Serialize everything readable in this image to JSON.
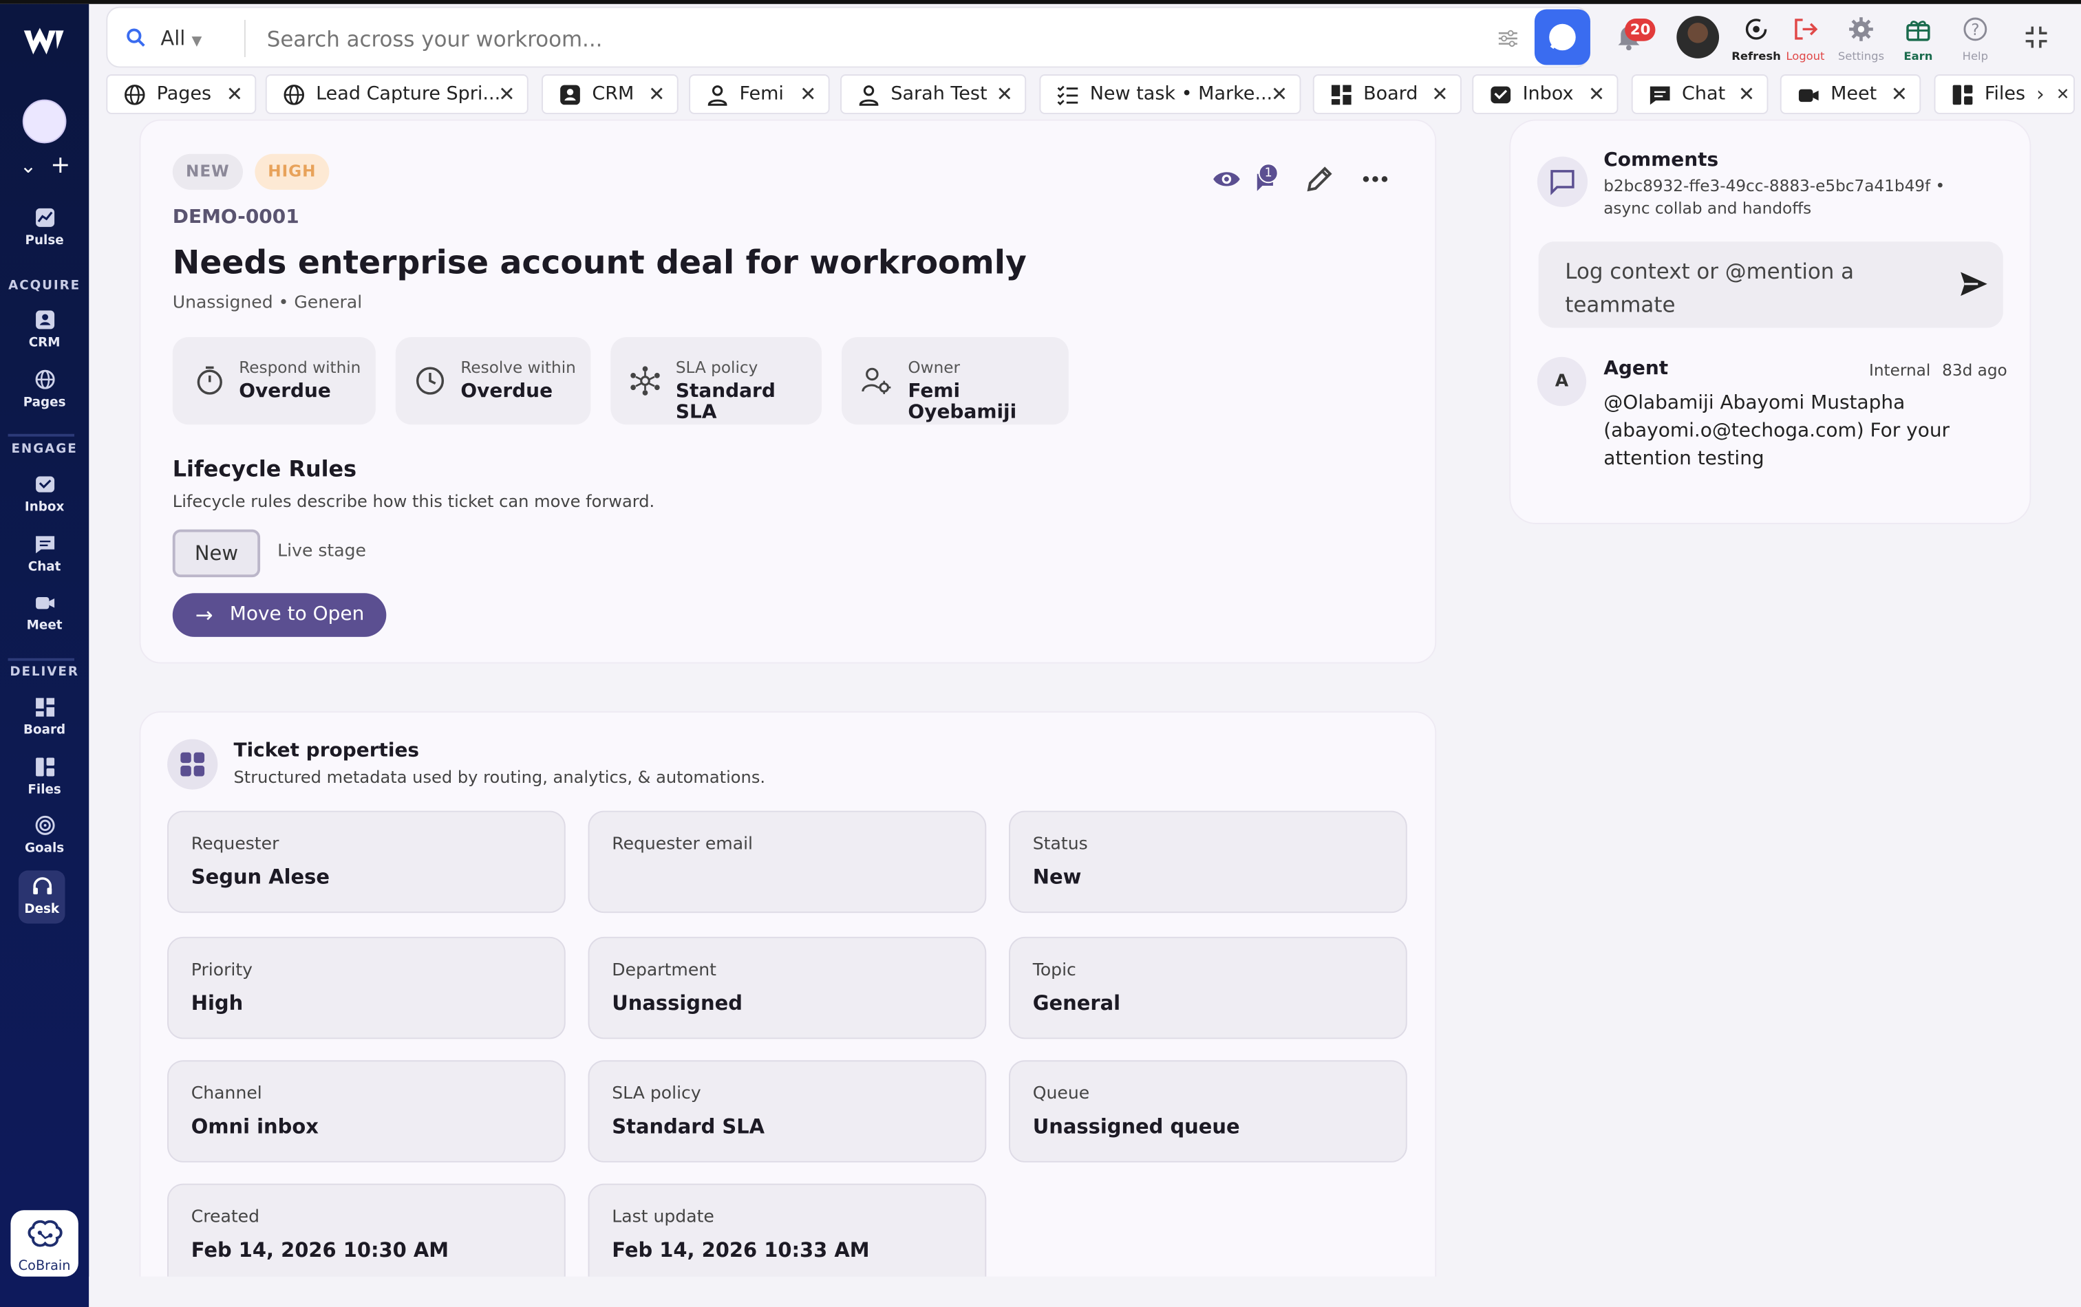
{
  "colors": {
    "accent": "#5b4f91",
    "sidebar": "#0d1a52",
    "search_button": "#3a6cf0",
    "notification_badge": "#e23b3b",
    "pill_new_bg": "#ebe9ef",
    "pill_high_bg": "#fde9d4",
    "pill_high_text": "#e8a25a"
  },
  "sidebar": {
    "items": [
      {
        "label": "Pulse",
        "icon": "pulse-icon"
      },
      {
        "label": "CRM",
        "icon": "crm-icon"
      },
      {
        "label": "Pages",
        "icon": "globe-icon"
      },
      {
        "label": "Inbox",
        "icon": "inbox-icon"
      },
      {
        "label": "Chat",
        "icon": "chat-icon"
      },
      {
        "label": "Meet",
        "icon": "video-icon"
      },
      {
        "label": "Board",
        "icon": "board-icon"
      },
      {
        "label": "Files",
        "icon": "files-icon"
      },
      {
        "label": "Goals",
        "icon": "target-icon"
      },
      {
        "label": "Desk",
        "icon": "headset-icon"
      }
    ],
    "sections": {
      "acquire": "ACQUIRE",
      "engage": "ENGAGE",
      "deliver": "DELIVER"
    },
    "cobrain": "CoBrain"
  },
  "topbar": {
    "scope": "All",
    "search_placeholder": "Search across your workroom...",
    "notifications": "20",
    "refresh": "Refresh",
    "logout": "Logout",
    "settings": "Settings",
    "earn": "Earn",
    "help": "Help"
  },
  "tabs": [
    {
      "label": "Pages",
      "icon": "globe-icon"
    },
    {
      "label": "Lead Capture Spri...",
      "icon": "globe-icon"
    },
    {
      "label": "CRM",
      "icon": "crm-icon"
    },
    {
      "label": "Femi",
      "icon": "person-icon"
    },
    {
      "label": "Sarah Test",
      "icon": "person-icon"
    },
    {
      "label": "New task • Marke...",
      "icon": "checklist-icon"
    },
    {
      "label": "Board",
      "icon": "board-icon"
    },
    {
      "label": "Inbox",
      "icon": "inbox-icon"
    },
    {
      "label": "Chat",
      "icon": "chat-icon"
    },
    {
      "label": "Meet",
      "icon": "video-icon"
    },
    {
      "label": "Files",
      "icon": "files-icon"
    }
  ],
  "ticket": {
    "status_pill": "NEW",
    "priority_pill": "HIGH",
    "id": "DEMO-0001",
    "title": "Needs enterprise account deal for workroomly",
    "subtitle": "Unassigned • General",
    "comment_count": "1",
    "sla": [
      {
        "label": "Respond within",
        "value": "Overdue",
        "icon": "timer-icon"
      },
      {
        "label": "Resolve within",
        "value": "Overdue",
        "icon": "clock-icon"
      },
      {
        "label": "SLA policy",
        "value": "Standard SLA",
        "icon": "network-icon"
      },
      {
        "label": "Owner",
        "value": "Femi Oyebamiji",
        "icon": "user-settings-icon"
      }
    ],
    "lifecycle": {
      "title": "Lifecycle Rules",
      "description": "Lifecycle rules describe how this ticket can move forward.",
      "stage": "New",
      "stage_note": "Live stage",
      "action": "Move to Open"
    }
  },
  "properties": {
    "title": "Ticket properties",
    "description": "Structured metadata used by routing, analytics, & automations.",
    "fields": [
      {
        "label": "Requester",
        "value": "Segun Alese"
      },
      {
        "label": "Requester email",
        "value": ""
      },
      {
        "label": "Status",
        "value": "New"
      },
      {
        "label": "Priority",
        "value": "High"
      },
      {
        "label": "Department",
        "value": "Unassigned"
      },
      {
        "label": "Topic",
        "value": "General"
      },
      {
        "label": "Channel",
        "value": "Omni inbox"
      },
      {
        "label": "SLA policy",
        "value": "Standard SLA"
      },
      {
        "label": "Queue",
        "value": "Unassigned queue"
      },
      {
        "label": "Created",
        "value": "Feb 14, 2026 10:30 AM"
      },
      {
        "label": "Last update",
        "value": "Feb 14, 2026 10:33 AM"
      }
    ]
  },
  "comments": {
    "title": "Comments",
    "meta_line1": "b2bc8932-ffe3-49cc-8883-e5bc7a41b49f •",
    "meta_line2": "async collab and handoffs",
    "input_placeholder": "Log context or @mention a teammate",
    "items": [
      {
        "avatar": "A",
        "author": "Agent",
        "visibility": "Internal",
        "time": "83d ago",
        "body": "@Olabamiji Abayomi Mustapha (abayomi.o@techoga.com) For your attention testing"
      }
    ]
  }
}
